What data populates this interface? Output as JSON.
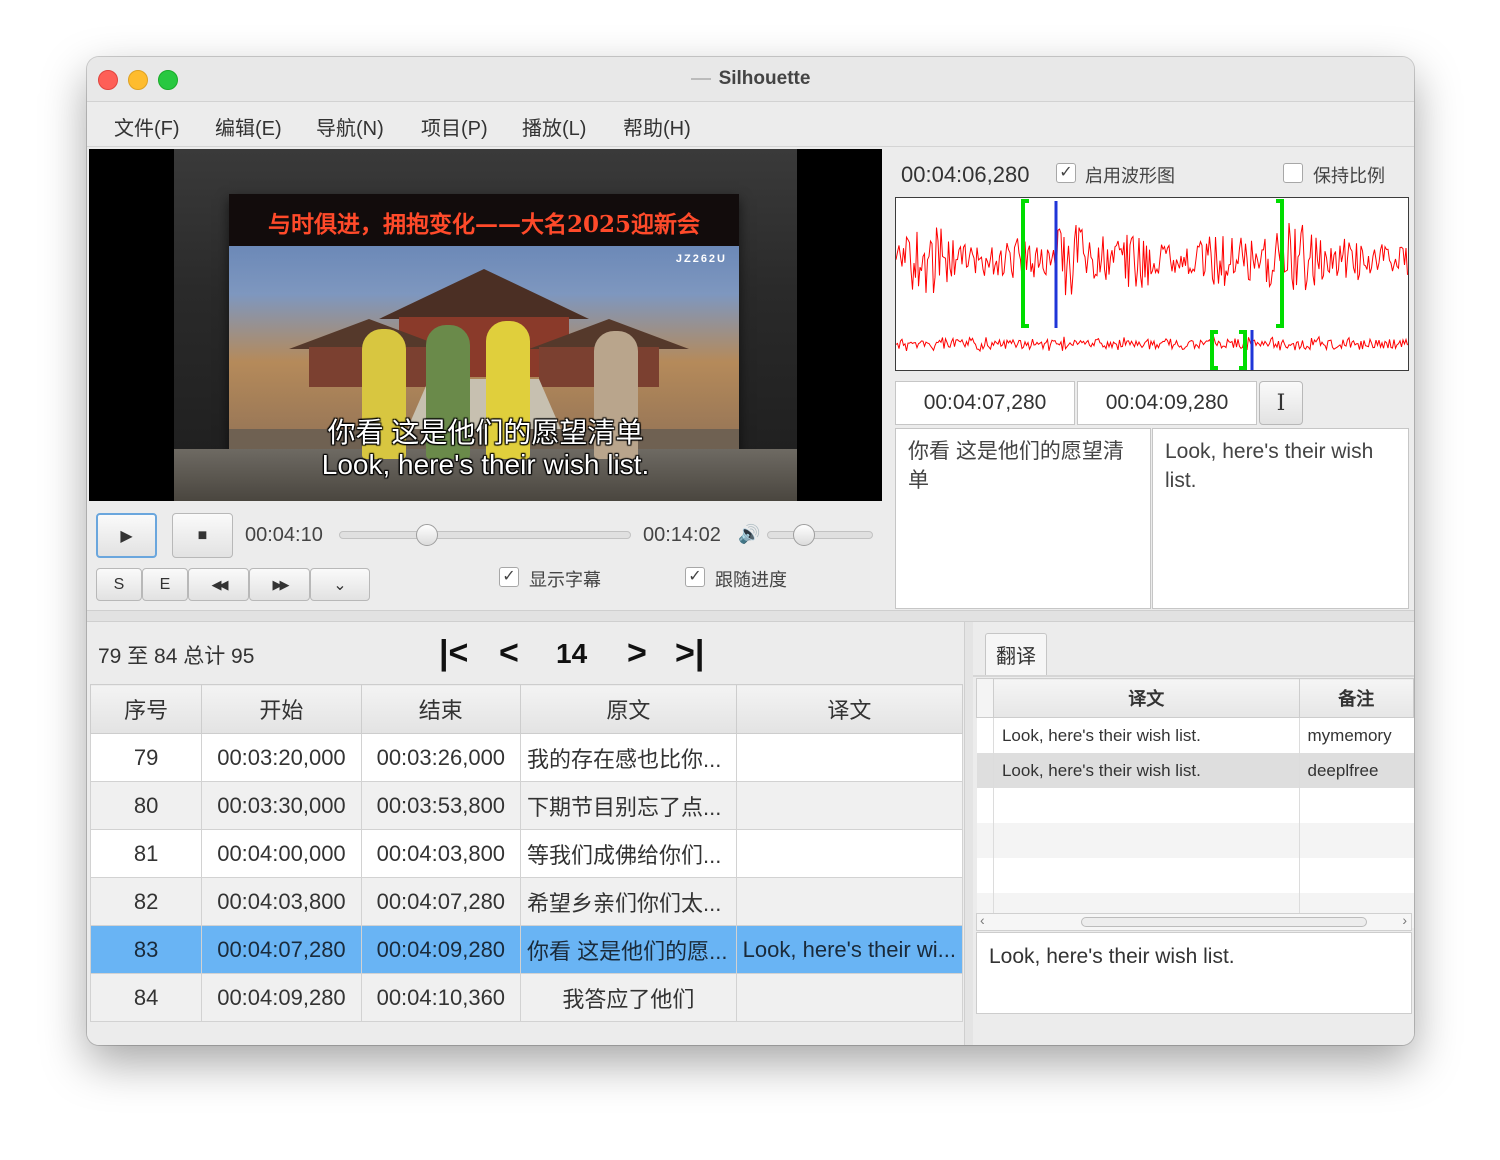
{
  "window": {
    "title": "Silhouette"
  },
  "menu": [
    "文件(F)",
    "编辑(E)",
    "导航(N)",
    "项目(P)",
    "播放(L)",
    "帮助(H)"
  ],
  "video": {
    "banner": "与时俱进，拥抱变化——大名2025迎新会",
    "screen_code": "JZ262U",
    "subtitle_cn": "你看 这是他们的愿望清单",
    "subtitle_en": "Look, here's their wish list."
  },
  "player": {
    "current_time": "00:04:10",
    "total_time": "00:14:02",
    "position_fraction": 0.3,
    "volume_fraction": 0.35,
    "play_icon": "▶",
    "stop_icon": "■",
    "s_label": "S",
    "e_label": "E",
    "rewind_icon": "◀◀",
    "forward_icon": "▶▶",
    "more_icon": "⌄",
    "show_subtitles": {
      "label": "显示字幕",
      "checked": true
    },
    "follow_progress": {
      "label": "跟随进度",
      "checked": true
    }
  },
  "waveform": {
    "timestamp": "00:04:06,280",
    "enable_waveform": {
      "label": "启用波形图",
      "checked": true
    },
    "keep_ratio": {
      "label": "保持比例",
      "checked": false
    }
  },
  "editor": {
    "start_time": "00:04:07,280",
    "end_time": "00:04:09,280",
    "cursor_icon": "I",
    "original": "你看 这是他们的愿望清单",
    "translation": "Look, here's their wish list."
  },
  "pager": {
    "info": "79 至 84 总计 95",
    "first_icon": "|<",
    "prev_icon": "<",
    "page": "14",
    "next_icon": ">",
    "last_icon": ">|"
  },
  "table": {
    "headers": [
      "序号",
      "开始",
      "结束",
      "原文",
      "译文"
    ],
    "rows": [
      {
        "no": "79",
        "start": "00:03:20,000",
        "end": "00:03:26,000",
        "orig": "我的存在感也比你...",
        "trans": ""
      },
      {
        "no": "80",
        "start": "00:03:30,000",
        "end": "00:03:53,800",
        "orig": "下期节目别忘了点...",
        "trans": ""
      },
      {
        "no": "81",
        "start": "00:04:00,000",
        "end": "00:04:03,800",
        "orig": "等我们成佛给你们...",
        "trans": ""
      },
      {
        "no": "82",
        "start": "00:04:03,800",
        "end": "00:04:07,280",
        "orig": "希望乡亲们你们太...",
        "trans": ""
      },
      {
        "no": "83",
        "start": "00:04:07,280",
        "end": "00:04:09,280",
        "orig": "你看 这是他们的愿...",
        "trans": "Look, here's their wi..."
      },
      {
        "no": "84",
        "start": "00:04:09,280",
        "end": "00:04:10,360",
        "orig": "我答应了他们",
        "trans": ""
      }
    ]
  },
  "translation_panel": {
    "tab": "翻译",
    "headers": [
      "译文",
      "备注"
    ],
    "rows": [
      {
        "text": "Look, here's their wish list.",
        "note": "mymemory"
      },
      {
        "text": "Look, here's their wish list.",
        "note": "deeplfree"
      }
    ],
    "result": "Look, here's their wish list."
  },
  "colors": {
    "selection": "#69b4f4",
    "waveform": "#ff0000",
    "marker": "#00dd00",
    "playhead": "#1f35d8"
  }
}
